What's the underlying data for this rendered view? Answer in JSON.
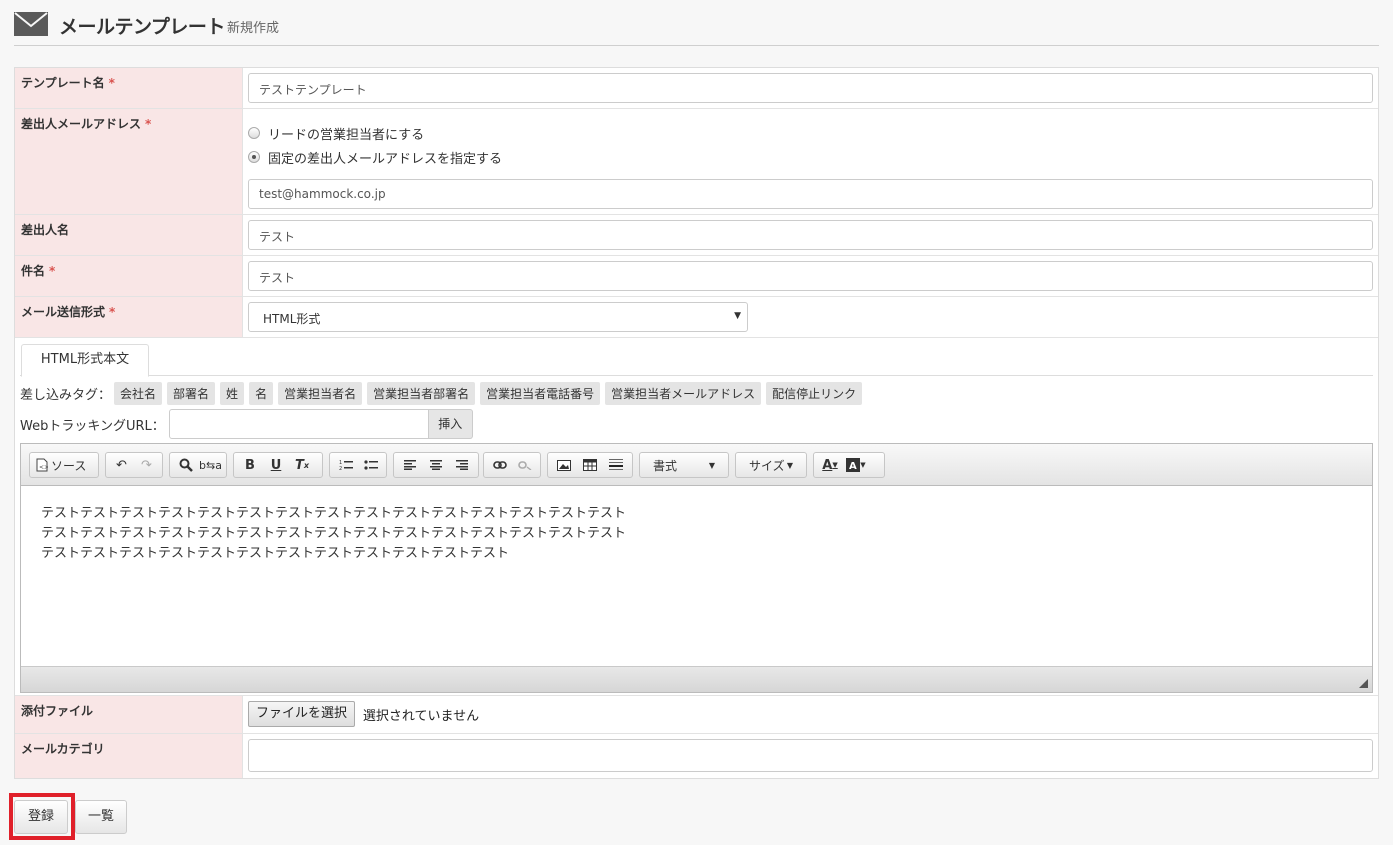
{
  "header": {
    "title": "メールテンプレート",
    "subtitle": "新規作成"
  },
  "fields": {
    "template_name": {
      "label": "テンプレート名",
      "required": "*",
      "value": "テストテンプレート"
    },
    "sender_address": {
      "label": "差出人メールアドレス",
      "required": "*",
      "options": [
        "リードの営業担当者にする",
        "固定の差出人メールアドレスを指定する"
      ],
      "selected_index": 1,
      "value": "test@hammock.co.jp"
    },
    "sender_name": {
      "label": "差出人名",
      "value": "テスト"
    },
    "subject": {
      "label": "件名",
      "required": "*",
      "value": "テスト"
    },
    "send_format": {
      "label": "メール送信形式",
      "required": "*",
      "value": "HTML形式"
    },
    "attachment": {
      "label": "添付ファイル",
      "button": "ファイルを選択",
      "status": "選択されていません"
    },
    "category": {
      "label": "メールカテゴリ",
      "value": ""
    }
  },
  "editor": {
    "tab": "HTML形式本文",
    "tags_label": "差し込みタグ：",
    "tags": [
      "会社名",
      "部署名",
      "姓",
      "名",
      "営業担当者名",
      "営業担当者部署名",
      "営業担当者電話番号",
      "営業担当者メールアドレス",
      "配信停止リンク"
    ],
    "tracking_label": "WebトラッキングURL：",
    "insert_button": "挿入",
    "toolbar": {
      "source": "ソース",
      "format": "書式",
      "size": "サイズ"
    },
    "content_lines": [
      "テストテストテストテストテストテストテストテストテストテストテストテストテストテストテスト",
      "テストテストテストテストテストテストテストテストテストテストテストテストテストテストテスト",
      "テストテストテストテストテストテストテストテストテストテストテストテスト"
    ]
  },
  "buttons": {
    "register": "登録",
    "list": "一覧"
  },
  "colors": {
    "label_bg": "#f9e6e6",
    "required": "#d9534f",
    "highlight": "#e0202a"
  }
}
